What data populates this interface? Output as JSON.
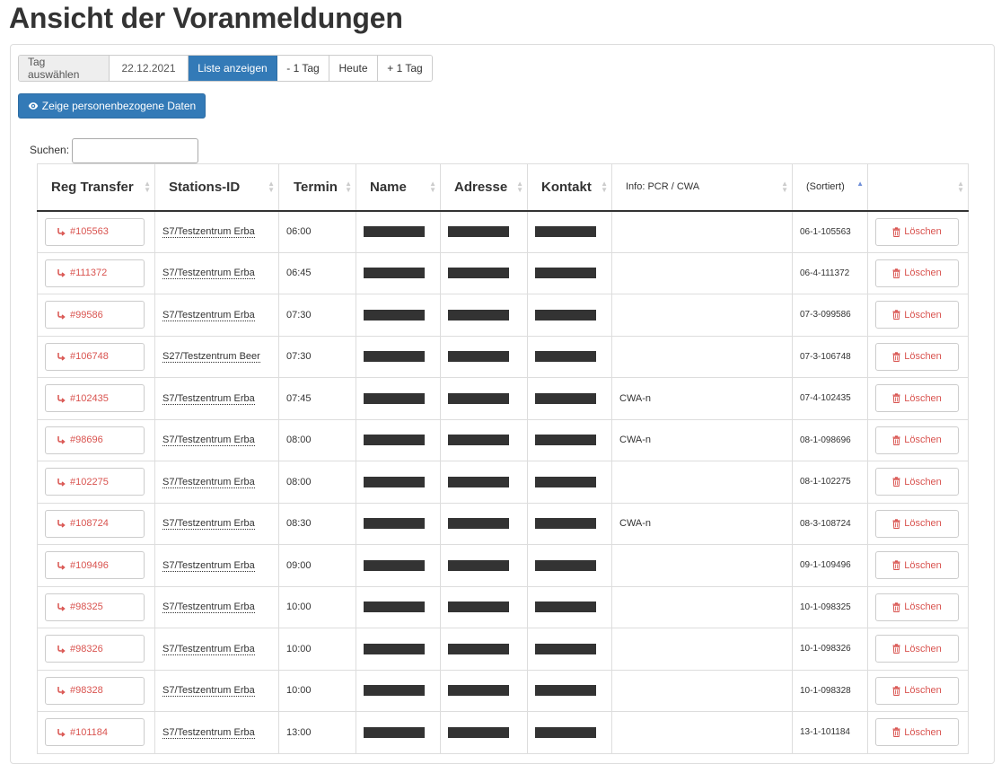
{
  "page": {
    "title": "Ansicht der Voranmeldungen"
  },
  "datebar": {
    "label": "Tag auswählen",
    "date": "22.12.2021",
    "show_label": "Liste anzeigen",
    "prev_label": "- 1 Tag",
    "today_label": "Heute",
    "next_label": "+ 1 Tag"
  },
  "personal_button": {
    "label": "Zeige personenbezogene Daten",
    "icon": "eye-icon"
  },
  "search": {
    "label": "Suchen:",
    "value": ""
  },
  "table": {
    "headers": [
      "Reg Transfer",
      "Stations-ID",
      "Termin",
      "Name",
      "Adresse",
      "Kontakt",
      "Info: PCR / CWA",
      "(Sortiert)",
      ""
    ],
    "delete_label": "Löschen",
    "rows": [
      {
        "reg": "#105563",
        "station": "S7/Testzentrum Erba",
        "time": "06:00",
        "info": "",
        "sort": "06-1-105563"
      },
      {
        "reg": "#111372",
        "station": "S7/Testzentrum Erba",
        "time": "06:45",
        "info": "",
        "sort": "06-4-111372"
      },
      {
        "reg": "#99586",
        "station": "S7/Testzentrum Erba",
        "time": "07:30",
        "info": "",
        "sort": "07-3-099586"
      },
      {
        "reg": "#106748",
        "station": "S27/Testzentrum Beer",
        "time": "07:30",
        "info": "",
        "sort": "07-3-106748"
      },
      {
        "reg": "#102435",
        "station": "S7/Testzentrum Erba",
        "time": "07:45",
        "info": "CWA-n",
        "sort": "07-4-102435"
      },
      {
        "reg": "#98696",
        "station": "S7/Testzentrum Erba",
        "time": "08:00",
        "info": "CWA-n",
        "sort": "08-1-098696"
      },
      {
        "reg": "#102275",
        "station": "S7/Testzentrum Erba",
        "time": "08:00",
        "info": "",
        "sort": "08-1-102275"
      },
      {
        "reg": "#108724",
        "station": "S7/Testzentrum Erba",
        "time": "08:30",
        "info": "CWA-n",
        "sort": "08-3-108724"
      },
      {
        "reg": "#109496",
        "station": "S7/Testzentrum Erba",
        "time": "09:00",
        "info": "",
        "sort": "09-1-109496"
      },
      {
        "reg": "#98325",
        "station": "S7/Testzentrum Erba",
        "time": "10:00",
        "info": "",
        "sort": "10-1-098325"
      },
      {
        "reg": "#98326",
        "station": "S7/Testzentrum Erba",
        "time": "10:00",
        "info": "",
        "sort": "10-1-098326"
      },
      {
        "reg": "#98328",
        "station": "S7/Testzentrum Erba",
        "time": "10:00",
        "info": "",
        "sort": "10-1-098328"
      },
      {
        "reg": "#101184",
        "station": "S7/Testzentrum Erba",
        "time": "13:00",
        "info": "",
        "sort": "13-1-101184"
      }
    ]
  },
  "colors": {
    "primary": "#337ab7",
    "danger": "#d9534f",
    "redaction": "#333333"
  }
}
